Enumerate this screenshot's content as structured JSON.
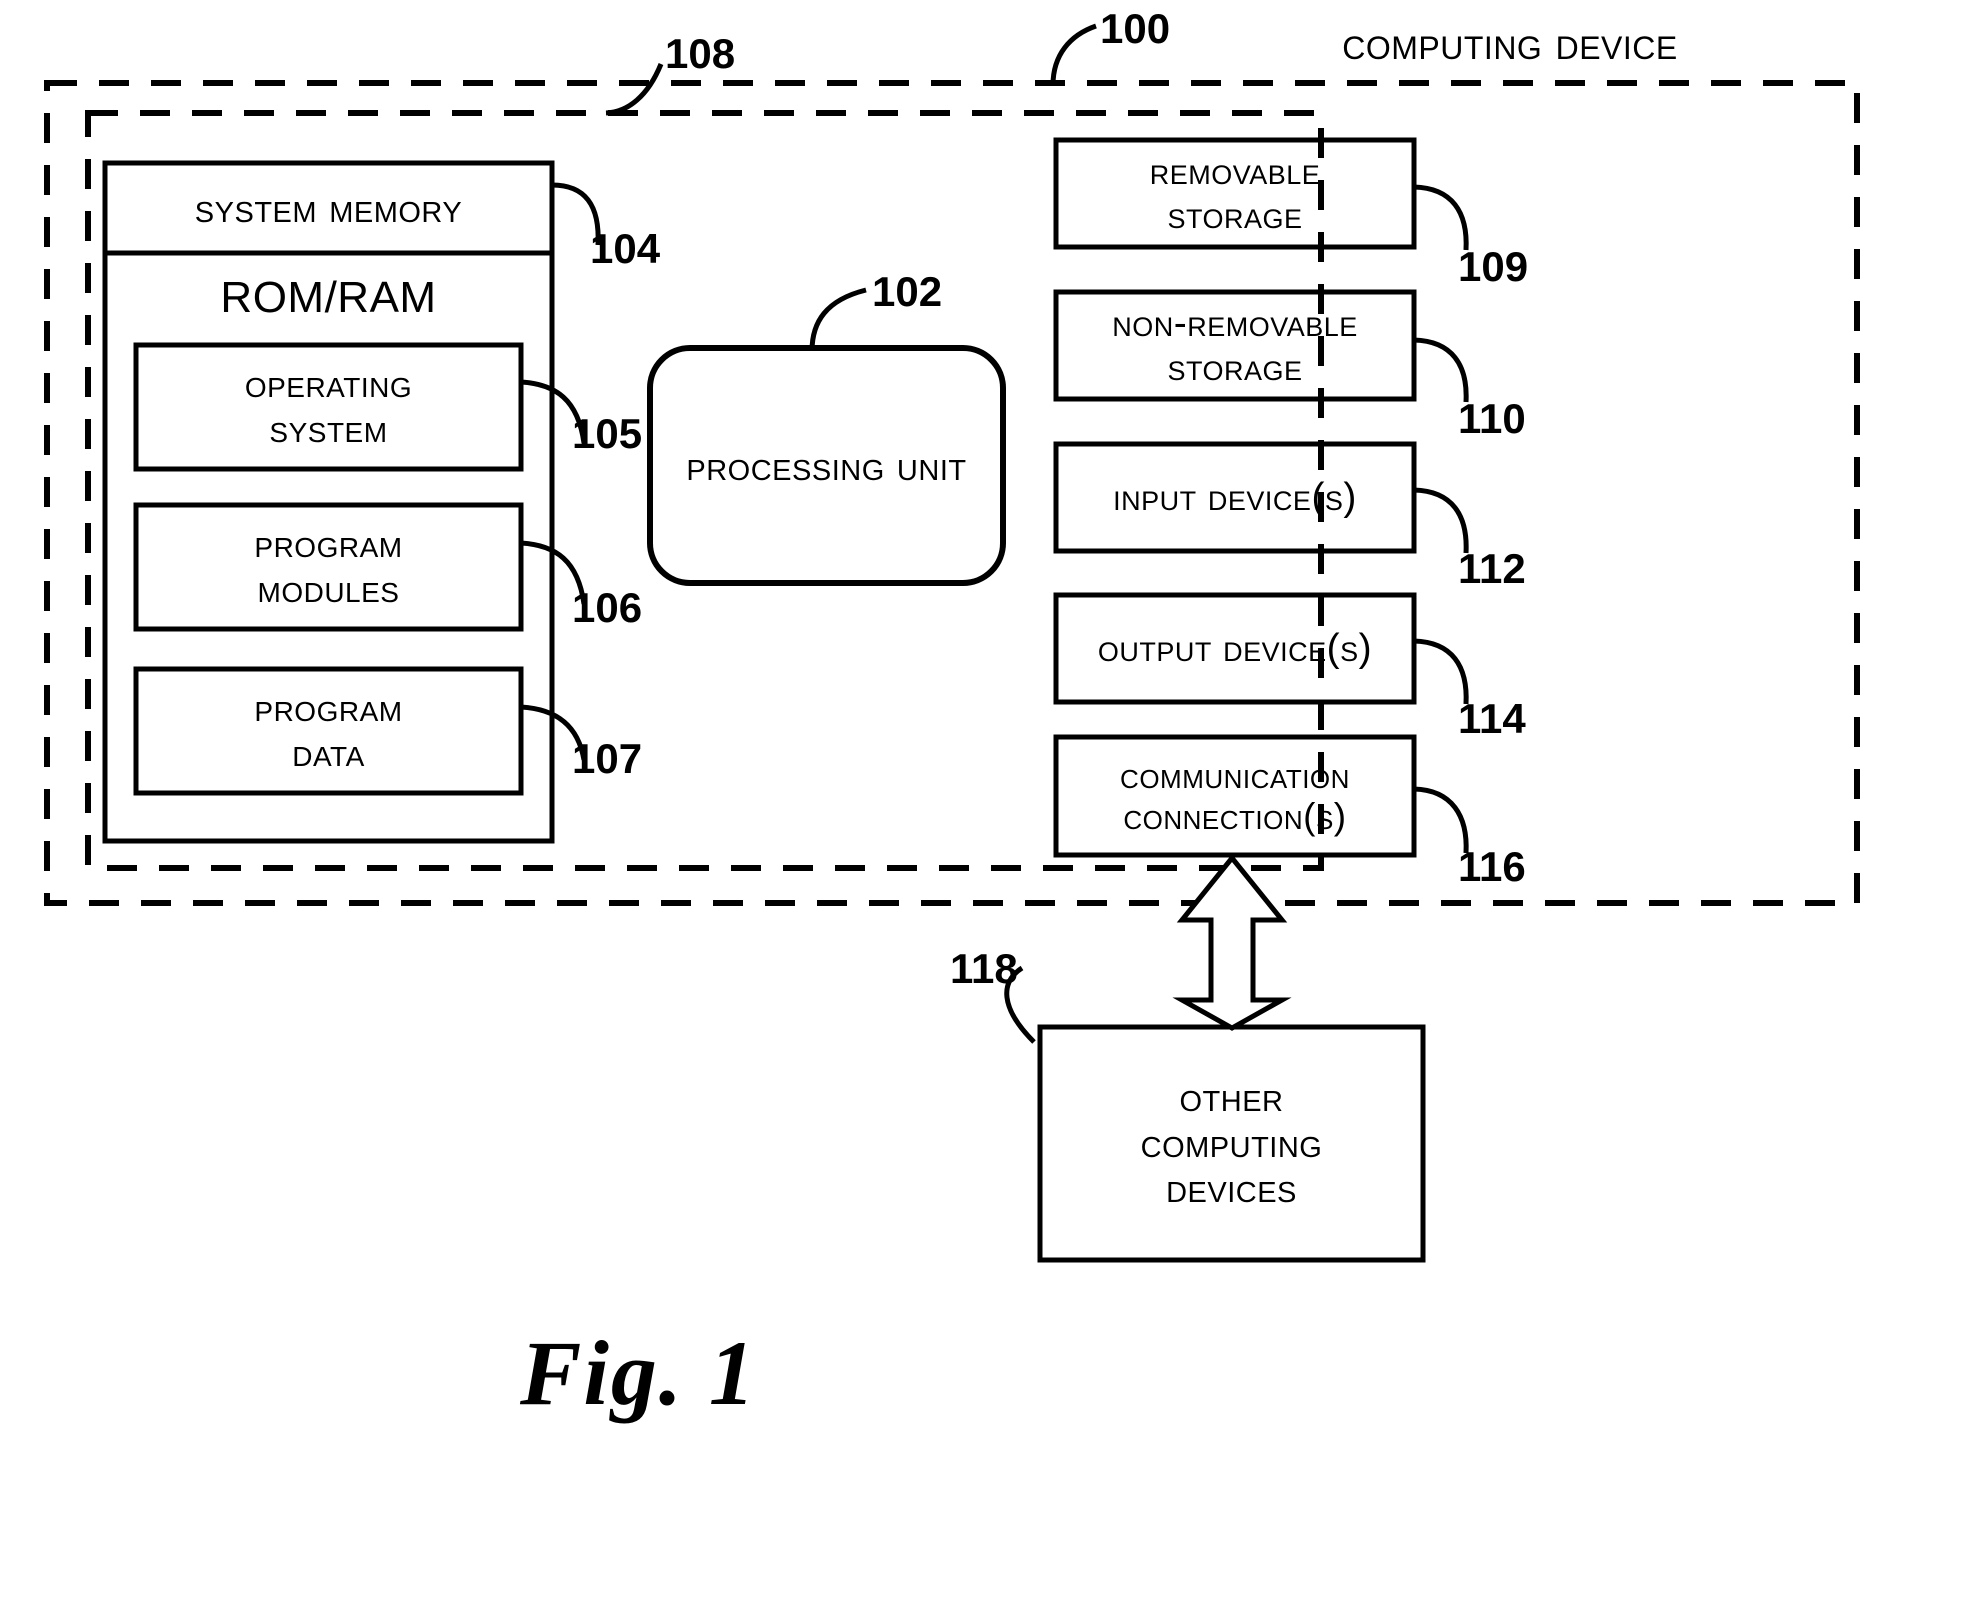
{
  "figure": {
    "caption": "Fig. 1",
    "title": "Computing Device"
  },
  "outer_boundary": {
    "label": "Computing Device",
    "ref": "100"
  },
  "inner_boundary": {
    "ref": "108"
  },
  "system_memory": {
    "title": "System Memory",
    "ref": "104",
    "subtitle": "ROM/RAM",
    "modules": [
      {
        "label": "Operating\nSystem",
        "ref": "105"
      },
      {
        "label": "Program\nModules",
        "ref": "106"
      },
      {
        "label": "Program\nData",
        "ref": "107"
      }
    ]
  },
  "processing_unit": {
    "label": "Processing Unit",
    "ref": "102"
  },
  "peripherals": [
    {
      "label": "Removable\nStorage",
      "ref": "109"
    },
    {
      "label": "Non-Removable\nStorage",
      "ref": "110"
    },
    {
      "label": "Input Device(s)",
      "ref": "112"
    },
    {
      "label": "Output Device(s)",
      "ref": "114"
    },
    {
      "label": "Communication\nConnection(s)",
      "ref": "116"
    }
  ],
  "other_devices": {
    "label": "Other\nComputing\nDevices",
    "ref": "118"
  },
  "colors": {
    "ink": "#000000",
    "paper": "#ffffff"
  }
}
